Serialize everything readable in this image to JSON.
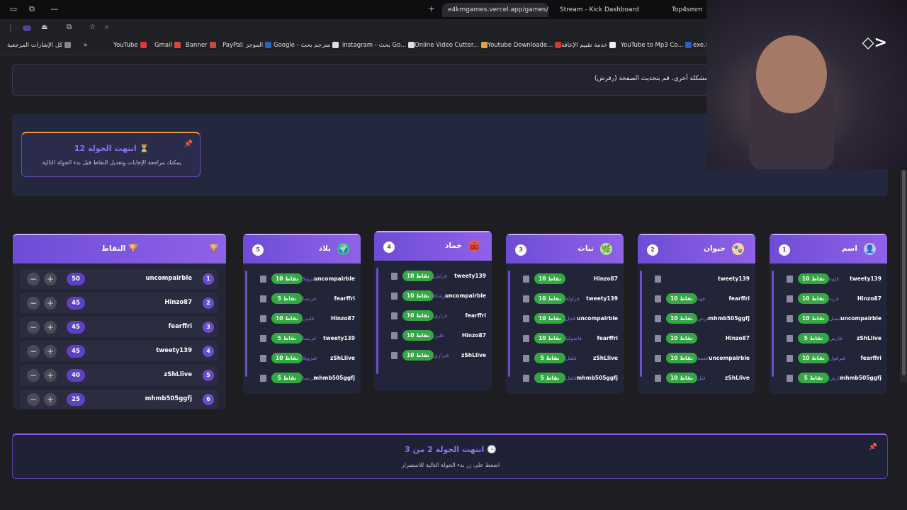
{
  "browser": {
    "tabs": [
      {
        "title": "e4kmgames.vercel.app/games/"
      },
      {
        "title": "Stream - Kick Dashboard"
      },
      {
        "title": "Top4smm"
      }
    ],
    "bookmarks": [
      "كل الإشارات المرجعية",
      "YouTube",
      "Gmail",
      "Banner",
      "PayPal: الموجز",
      "Google - مترجم بحث",
      "instagram - بحث Go...",
      "Online Video Cutter...",
      "Youtube Downloade...",
      "خدمة تقييم الإعاقة",
      "YouTube to Mp3 Co...",
      "exe.io"
    ]
  },
  "notice": "مشكلة أخرى، قم بتحديث الصفحة (رفرش).",
  "round_card": {
    "title": "انتهت الجولة 12",
    "subtitle": "يمكنك مراجعة الإجابات وتعديل النقاط قبل بدء الجولة التالية"
  },
  "scores": {
    "title": "النقاط",
    "players": [
      {
        "rank": "1",
        "name": "uncompairble",
        "points": "50"
      },
      {
        "rank": "2",
        "name": "Hinzo87",
        "points": "45"
      },
      {
        "rank": "3",
        "name": "fearffri",
        "points": "45"
      },
      {
        "rank": "4",
        "name": "tweety139",
        "points": "45"
      },
      {
        "rank": "5",
        "name": "zShLlive",
        "points": "40"
      },
      {
        "rank": "6",
        "name": "mhmb505ggfj",
        "points": "25"
      }
    ]
  },
  "categories": [
    {
      "num": "1",
      "title": "اسم",
      "answers": [
        {
          "player": "tweety139",
          "answer": "فلوه",
          "points": "10 نقاط"
        },
        {
          "player": "Hinzo87",
          "answer": "فريد",
          "points": "10 نقاط"
        },
        {
          "player": "uncompairble",
          "answer": "فيصل",
          "points": "10 نقاط"
        },
        {
          "player": "zShLlive",
          "answer": "فارس",
          "points": "5 نقاط"
        },
        {
          "player": "fearffri",
          "answer": "فيرفول",
          "points": "10 نقاط"
        },
        {
          "player": "mhmb505ggfj",
          "answer": "فارس",
          "points": "5 نقاط"
        }
      ]
    },
    {
      "num": "2",
      "title": "حيوان",
      "answers": [
        {
          "player": "tweety139",
          "answer": "",
          "points": ""
        },
        {
          "player": "fearffri",
          "answer": "فهد",
          "points": "10 نقاط"
        },
        {
          "player": "mhmb505ggfj",
          "answer": "فرس",
          "points": "10 نقاط"
        },
        {
          "player": "Hinzo87",
          "answer": "",
          "points": "10 نقاط"
        },
        {
          "player": "uncompairble",
          "answer": "فقمة",
          "points": "10 نقاط"
        },
        {
          "player": "zShLlive",
          "answer": "فيل",
          "points": "10 نقاط"
        }
      ]
    },
    {
      "num": "3",
      "title": "نبات",
      "answers": [
        {
          "player": "Hinzo87",
          "answer": "",
          "points": "10 نقاط"
        },
        {
          "player": "tweety139",
          "answer": "فراولة",
          "points": "10 نقاط"
        },
        {
          "player": "uncompairble",
          "answer": "فجل",
          "points": "10 نقاط"
        },
        {
          "player": "fearffri",
          "answer": "فاصوليا",
          "points": "10 نقاط"
        },
        {
          "player": "zShLlive",
          "answer": "فلفل",
          "points": "5 نقاط"
        },
        {
          "player": "mhmb505ggfj",
          "answer": "فلفل",
          "points": "5 نقاط"
        }
      ]
    },
    {
      "num": "4",
      "title": "جماد",
      "answers": [
        {
          "player": "tweety139",
          "answer": "فراش",
          "points": "10 نقاط"
        },
        {
          "player": "uncompairble",
          "answer": "فرشاة",
          "points": "10 نقاط"
        },
        {
          "player": "fearffri",
          "answer": "فراري",
          "points": "10 نقاط"
        },
        {
          "player": "Hinzo87",
          "answer": "فلين",
          "points": "10 نقاط"
        },
        {
          "player": "zShLlive",
          "answer": "فيراري",
          "points": "10 نقاط"
        }
      ]
    },
    {
      "num": "5",
      "title": "بلاد",
      "answers": [
        {
          "player": "uncompairble",
          "answer": "فنزويلا",
          "points": "10 نقاط"
        },
        {
          "player": "fearffri",
          "answer": "فرنسا",
          "points": "5 نقاط"
        },
        {
          "player": "Hinzo87",
          "answer": "فلبين",
          "points": "10 نقاط"
        },
        {
          "player": "tweety139",
          "answer": "فرنسا",
          "points": "5 نقاط"
        },
        {
          "player": "zShLlive",
          "answer": "فنزويلا",
          "points": "10 نقاط"
        },
        {
          "player": "mhmb505ggfj",
          "answer": "فرنسا",
          "points": "5 نقاط"
        }
      ]
    }
  ],
  "round_end": {
    "title": "انتهت الجولة 2 من 3",
    "subtitle": "اضغط على زر بدء الجولة التالية للاستمرار"
  },
  "colors": {
    "accent": "#7c5ce0",
    "points_pill": "#35a845",
    "page_bg": "#1e1e22"
  }
}
